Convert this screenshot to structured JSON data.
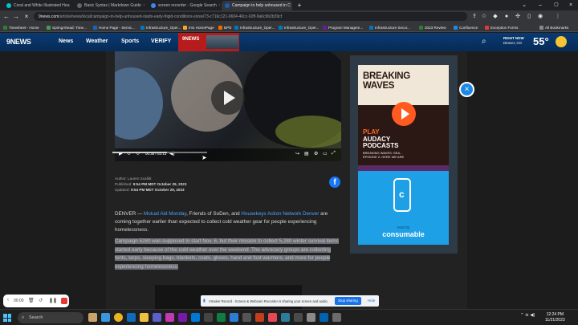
{
  "browser": {
    "tabs": [
      {
        "title": "Coral and White Illustrated Hea",
        "favicon_color": "#00c4cc"
      },
      {
        "title": "Basic Syntax | Markdown Guide",
        "favicon_color": "#333333"
      },
      {
        "title": "screen recorder - Google Search",
        "favicon_color": "#4285f4"
      },
      {
        "title": "Campaign to help unhoused in C",
        "favicon_color": "#1a5fb4"
      }
    ],
    "url_host": "9news.com",
    "url_path": "/article/news/local/campaign-to-help-unhoused-starts-early-frigid-conditions-snow/73-c716c121-0604-40cc-92ff-9a6c9b2b39cf",
    "bookmarks": [
      {
        "label": "Timesheet - Home",
        "color": "#2e7d32"
      },
      {
        "label": "SpringAhead: Time...",
        "color": "#43a047"
      },
      {
        "label": "Home Page - Servic...",
        "color": "#1565c0"
      },
      {
        "label": "Infrastructure_Oper...",
        "color": "#0277bd"
      },
      {
        "label": "Ims HomePage",
        "color": "#f9a825"
      },
      {
        "label": "BPD",
        "color": "#ef6c00"
      },
      {
        "label": "Infrastructure_Oper...",
        "color": "#0277bd"
      },
      {
        "label": "Infrastructure_Oper...",
        "color": "#0277bd"
      },
      {
        "label": "Program Managem...",
        "color": "#6a1b9a"
      },
      {
        "label": "Infrastructure Secur...",
        "color": "#0277bd"
      },
      {
        "label": "2023 Review",
        "color": "#2e7d32"
      },
      {
        "label": "Confluence",
        "color": "#1e88e5"
      },
      {
        "label": "Exception Forms",
        "color": "#e53935"
      }
    ],
    "all_bookmarks": "All Bookmarks"
  },
  "site": {
    "logo": "9NEWS",
    "nav": [
      "News",
      "Weather",
      "Sports",
      "VERIFY"
    ],
    "live_logo": "9NEWS",
    "weather_label": "RIGHT NOW",
    "weather_location": "Denver, CO",
    "temperature": "55°"
  },
  "video": {
    "time": "00:38 / 02:13",
    "progress": 0.58
  },
  "article": {
    "author": "Author: Lauren Scafidi",
    "published_label": "Published:",
    "published": "9:54 PM MDT October 29, 2023",
    "updated_label": "Updated:",
    "updated": "9:54 PM MDT October 29, 2023",
    "p1_start": "DENVER — ",
    "p1_link1": "Mutual Aid Monday",
    "p1_mid": ", Friends of SoDen, and ",
    "p1_link2": "Housekeys Action Network Denver",
    "p1_end": " are coming together earlier than expected to collect cold weather gear for people experiencing homelessness.",
    "p2": "Campaign 5280 was supposed to start Nov. 6, but their mission to collect 5,280 winter survival items started early because of the cold weather over the weekend. The advocacy groups are collecting tents, tarps, sleeping bags, blankets, coats, gloves, hand and foot warmers, and more for people experiencing homelessness."
  },
  "ads": {
    "ad1_title_line1": "BREAKING",
    "ad1_title_line2": "WAVES",
    "ad1_cta_line1": "PLAY",
    "ad1_cta_line2": "AUDACY",
    "ad1_cta_line3": "PODCASTS",
    "ad1_episode_line1": "BREAKING WAVES: SEA...",
    "ad1_episode_line2": "EPISODE 2: HERE WE ARE",
    "ad2_now_by": "now by",
    "ad2_brand": "consumable"
  },
  "recorder": {
    "time": "00:00"
  },
  "share_banner": {
    "text": "Vmaker Record - Screen & Webcam Recorder is sharing your screen and audio.",
    "stop": "Stop sharing",
    "hide": "Hide"
  },
  "taskbar": {
    "search": "Search",
    "time": "12:24 PM",
    "date": "11/21/2023"
  }
}
